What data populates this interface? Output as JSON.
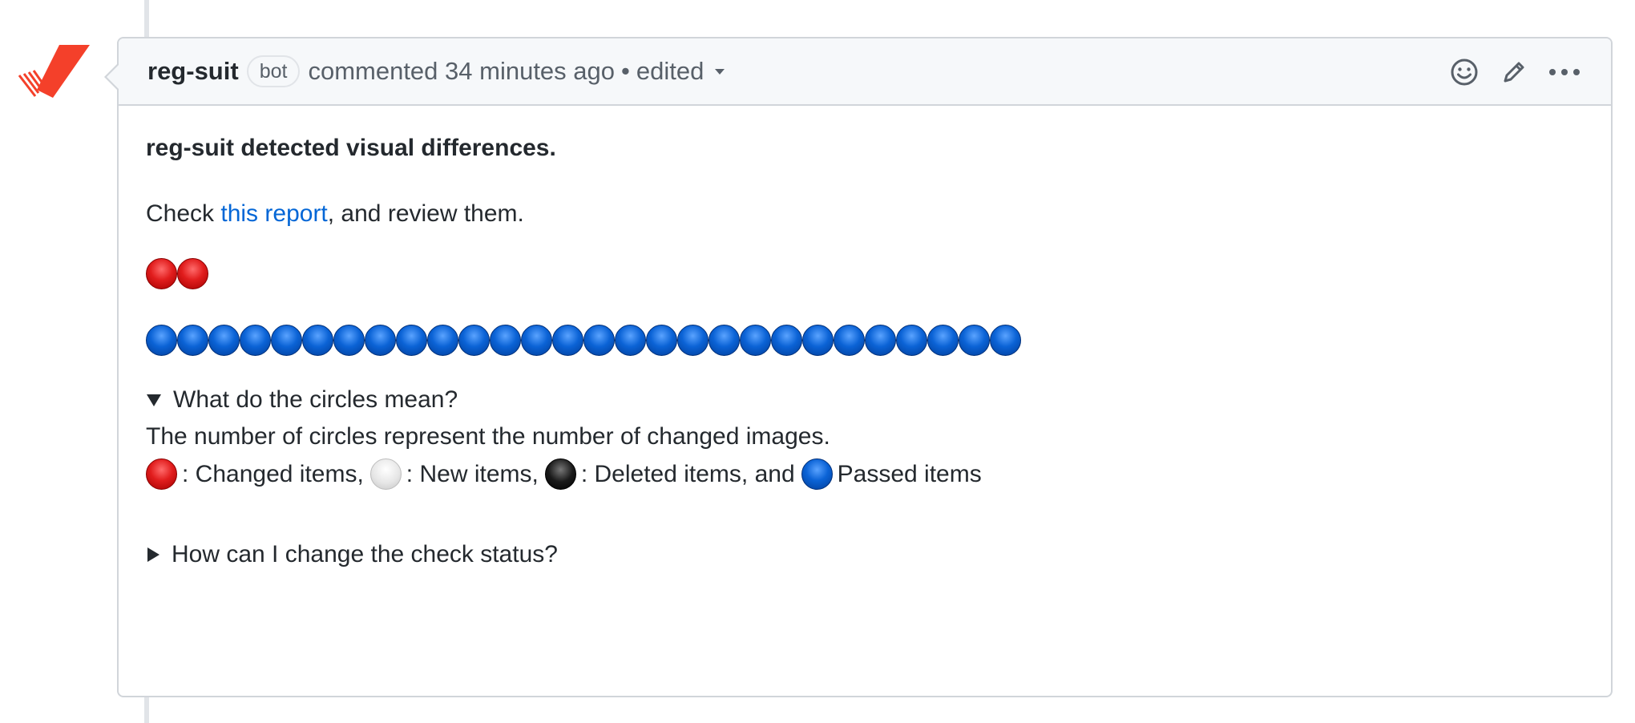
{
  "comment": {
    "author": "reg-suit",
    "badge": "bot",
    "action": "commented 34 minutes ago",
    "edited": "edited",
    "meta_separator": "•"
  },
  "body": {
    "headline": "reg-suit detected visual differences.",
    "check_prefix": "Check ",
    "check_link": "this report",
    "check_suffix": ", and review them.",
    "changed_count": 2,
    "passed_count": 28,
    "details_open": {
      "summary": "What do the circles mean?",
      "text": "The number of circles represent the number of changed images.",
      "legend": {
        "changed": ": Changed items,",
        "new": ": New items,",
        "deleted": ": Deleted items, and",
        "passed": "Passed items"
      }
    },
    "details_closed": {
      "summary": "How can I change the check status?"
    }
  },
  "colors": {
    "link": "#0366d6",
    "avatar_red": "#f4402a",
    "header_bg": "#f6f8fa",
    "border": "#d1d5da"
  },
  "icons": [
    "smiley-icon",
    "pencil-icon",
    "kebab-menu-icon",
    "reg-suit-logo"
  ]
}
